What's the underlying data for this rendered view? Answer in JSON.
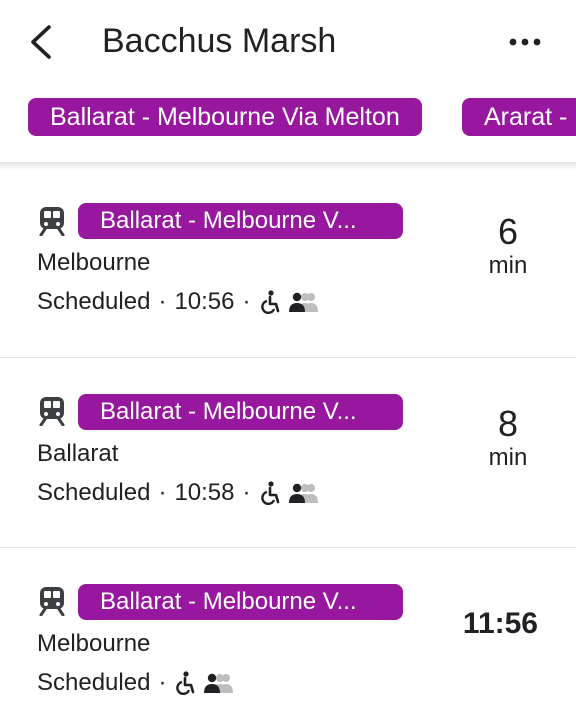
{
  "header": {
    "title": "Bacchus Marsh"
  },
  "route_chips": [
    {
      "label": "Ballarat - Melbourne Via Melton"
    },
    {
      "label": "Ararat - Melbourne"
    }
  ],
  "departures": [
    {
      "route_label": "Ballarat - Melbourne V...",
      "destination": "Melbourne",
      "status": "Scheduled",
      "time": "10:56",
      "eta_number": "6",
      "eta_unit": "min"
    },
    {
      "route_label": "Ballarat - Melbourne V...",
      "destination": "Ballarat",
      "status": "Scheduled",
      "time": "10:58",
      "eta_number": "8",
      "eta_unit": "min"
    },
    {
      "route_label": "Ballarat - Melbourne V...",
      "destination": "Melbourne",
      "status": "Scheduled",
      "eta_time": "11:56"
    }
  ],
  "colors": {
    "route_chip": "#97189e",
    "text": "#202124",
    "separator": "#e3e3e3",
    "icon": "#3c4043",
    "crowd_empty": "#bdbdbd"
  },
  "icons": [
    "back-arrow-icon",
    "more-vert-icon",
    "train-icon",
    "wheelchair-accessible-icon",
    "crowding-icon"
  ]
}
